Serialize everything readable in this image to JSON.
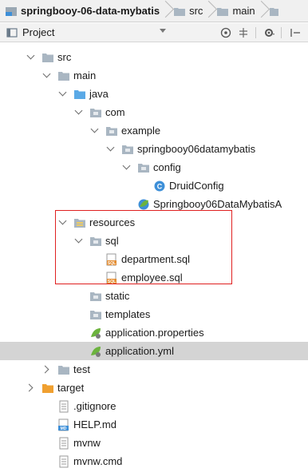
{
  "breadcrumb": [
    "springbooy-06-data-mybatis",
    "src",
    "main"
  ],
  "toolbar": {
    "label": "Project"
  },
  "tree": [
    {
      "label": "src",
      "icon": "folder-gray",
      "arrow": "open",
      "level": 1
    },
    {
      "label": "main",
      "icon": "folder-gray",
      "arrow": "open",
      "level": 2
    },
    {
      "label": "java",
      "icon": "folder-blue",
      "arrow": "open",
      "level": 3
    },
    {
      "label": "com",
      "icon": "package",
      "arrow": "open",
      "level": 4
    },
    {
      "label": "example",
      "icon": "package",
      "arrow": "open",
      "level": 5
    },
    {
      "label": "springbooy06datamybatis",
      "icon": "package",
      "arrow": "open",
      "level": 6
    },
    {
      "label": "config",
      "icon": "package",
      "arrow": "open",
      "level": 7
    },
    {
      "label": "DruidConfig",
      "icon": "class",
      "arrow": "none",
      "level": 8
    },
    {
      "label": "Springbooy06DataMybatisA",
      "icon": "spring-class",
      "arrow": "none",
      "level": 7
    },
    {
      "label": "resources",
      "icon": "resources-folder",
      "arrow": "open",
      "level": 3
    },
    {
      "label": "sql",
      "icon": "package",
      "arrow": "open",
      "level": 4
    },
    {
      "label": "department.sql",
      "icon": "sql-file",
      "arrow": "none",
      "level": 5
    },
    {
      "label": "employee.sql",
      "icon": "sql-file",
      "arrow": "none",
      "level": 5
    },
    {
      "label": "static",
      "icon": "package",
      "arrow": "none",
      "level": 4
    },
    {
      "label": "templates",
      "icon": "package",
      "arrow": "none",
      "level": 4
    },
    {
      "label": "application.properties",
      "icon": "spring-properties",
      "arrow": "none",
      "level": 4
    },
    {
      "label": "application.yml",
      "icon": "spring-properties",
      "arrow": "none",
      "level": 4,
      "selected": true
    },
    {
      "label": "test",
      "icon": "folder-gray",
      "arrow": "closed",
      "level": 2
    },
    {
      "label": "target",
      "icon": "folder-orange",
      "arrow": "closed",
      "level": 1
    },
    {
      "label": ".gitignore",
      "icon": "text-file",
      "arrow": "none",
      "level": 2
    },
    {
      "label": "HELP.md",
      "icon": "md-file",
      "arrow": "none",
      "level": 2
    },
    {
      "label": "mvnw",
      "icon": "text-file",
      "arrow": "none",
      "level": 2
    },
    {
      "label": "mvnw.cmd",
      "icon": "text-file",
      "arrow": "none",
      "level": 2
    }
  ],
  "icon_text": {
    "class": "C",
    "md": "MD",
    "sql": "SQL"
  },
  "colors": {
    "selection": "#d4d4d4",
    "highlight_border": "#e02020",
    "folder_blue": "#5aa9e6",
    "folder_orange": "#f0a030",
    "folder_gray": "#a9b6c2"
  }
}
